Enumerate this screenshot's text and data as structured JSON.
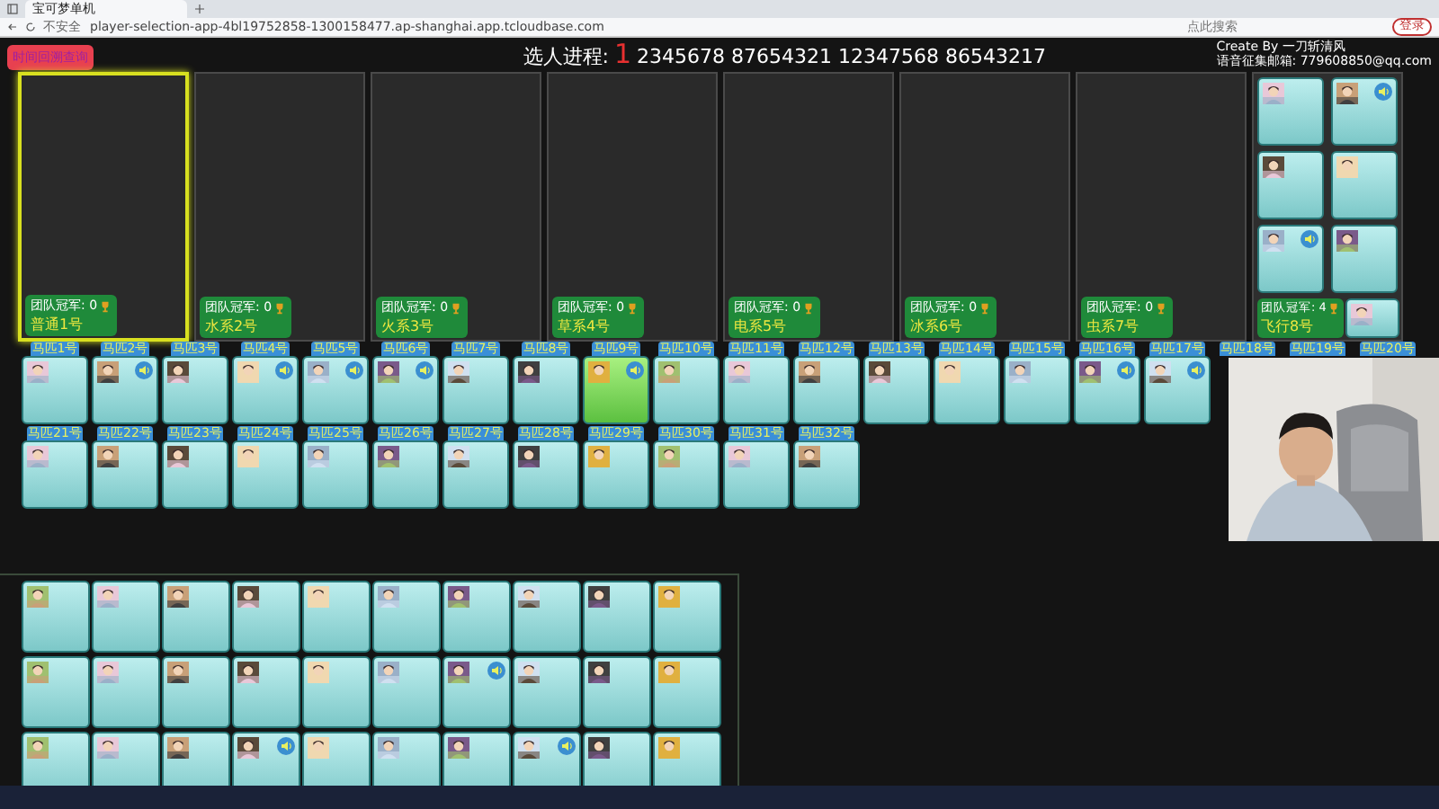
{
  "browser": {
    "tab_title": "宝可梦单机",
    "security": "不安全",
    "address": "player-selection-app-4bl19752858-1300158477.ap-shanghai.app.tcloudbase.com",
    "search_placeholder": "点此搜索",
    "login_button": "登录"
  },
  "header": {
    "history_button": "时间回溯查询",
    "progress_label": "选人进程:",
    "current_pick": "1",
    "pick_order": "2345678 87654321 12347568 86543217",
    "credit": "Create By 一刀斩清风",
    "contact": "语音征集邮箱: 779608850@qq.com"
  },
  "teams": [
    {
      "label": "团队冠军: 0",
      "name": "普通1号",
      "selected": true
    },
    {
      "label": "团队冠军: 0",
      "name": "水系2号",
      "selected": false
    },
    {
      "label": "团队冠军: 0",
      "name": "火系3号",
      "selected": false
    },
    {
      "label": "团队冠军: 0",
      "name": "草系4号",
      "selected": false
    },
    {
      "label": "团队冠军: 0",
      "name": "电系5号",
      "selected": false
    },
    {
      "label": "团队冠军: 0",
      "name": "冰系6号",
      "selected": false
    },
    {
      "label": "团队冠军: 0",
      "name": "虫系7号",
      "selected": false
    }
  ],
  "team8": {
    "label": "团队冠军: 4",
    "name": "飞行8号",
    "members": [
      {
        "sound": false
      },
      {
        "sound": true
      },
      {
        "sound": false
      },
      {
        "sound": false
      },
      {
        "sound": true
      },
      {
        "sound": false
      },
      {
        "sound": false
      }
    ]
  },
  "draft_rows": [
    [
      {
        "h": "马匹1号",
        "sound": false,
        "selected": false
      },
      {
        "h": "马匹2号",
        "sound": true,
        "selected": false
      },
      {
        "h": "马匹3号",
        "sound": false,
        "selected": false
      },
      {
        "h": "马匹4号",
        "sound": true,
        "selected": false
      },
      {
        "h": "马匹5号",
        "sound": true,
        "selected": false
      },
      {
        "h": "马匹6号",
        "sound": true,
        "selected": false
      },
      {
        "h": "马匹7号",
        "sound": false,
        "selected": false
      },
      {
        "h": "马匹8号",
        "sound": false,
        "selected": false
      },
      {
        "h": "马匹9号",
        "sound": true,
        "selected": true
      },
      {
        "h": "马匹10号",
        "sound": false,
        "selected": false
      },
      {
        "h": "马匹11号",
        "sound": false,
        "selected": false
      },
      {
        "h": "马匹12号",
        "sound": false,
        "selected": false
      },
      {
        "h": "马匹13号",
        "sound": false,
        "selected": false
      },
      {
        "h": "马匹14号",
        "sound": false,
        "selected": false
      },
      {
        "h": "马匹15号",
        "sound": false,
        "selected": false
      },
      {
        "h": "马匹16号",
        "sound": true,
        "selected": false
      },
      {
        "h": "马匹17号",
        "sound": true,
        "selected": false
      },
      {
        "h": "马匹18号"
      },
      {
        "h": "马匹19号"
      },
      {
        "h": "马匹20号"
      }
    ],
    [
      {
        "h": "马匹21号",
        "sound": false,
        "selected": false
      },
      {
        "h": "马匹22号",
        "sound": false,
        "selected": false
      },
      {
        "h": "马匹23号",
        "sound": false,
        "selected": false
      },
      {
        "h": "马匹24号",
        "sound": false,
        "selected": false
      },
      {
        "h": "马匹25号",
        "sound": false,
        "selected": false
      },
      {
        "h": "马匹26号",
        "sound": false,
        "selected": false
      },
      {
        "h": "马匹27号",
        "sound": false,
        "selected": false
      },
      {
        "h": "马匹28号",
        "sound": false,
        "selected": false
      },
      {
        "h": "马匹29号",
        "sound": false,
        "selected": false
      },
      {
        "h": "马匹30号",
        "sound": false,
        "selected": false
      },
      {
        "h": "马匹31号",
        "sound": false,
        "selected": false
      },
      {
        "h": "马匹32号",
        "sound": false,
        "selected": false
      }
    ]
  ],
  "pool_rows": [
    [
      {
        "sound": false
      },
      {
        "sound": false
      },
      {
        "sound": false
      },
      {
        "sound": false
      },
      {
        "sound": false
      },
      {
        "sound": false
      },
      {
        "sound": false
      },
      {
        "sound": false
      },
      {
        "sound": false
      },
      {
        "sound": false
      }
    ],
    [
      {
        "sound": false
      },
      {
        "sound": false
      },
      {
        "sound": false
      },
      {
        "sound": false
      },
      {
        "sound": false
      },
      {
        "sound": false
      },
      {
        "sound": true
      },
      {
        "sound": false
      },
      {
        "sound": false
      },
      {
        "sound": false
      }
    ],
    [
      {
        "sound": false
      },
      {
        "sound": false
      },
      {
        "sound": false
      },
      {
        "sound": true
      },
      {
        "sound": false
      },
      {
        "sound": false
      },
      {
        "sound": false
      },
      {
        "sound": true
      },
      {
        "sound": false
      },
      {
        "sound": false
      }
    ]
  ]
}
